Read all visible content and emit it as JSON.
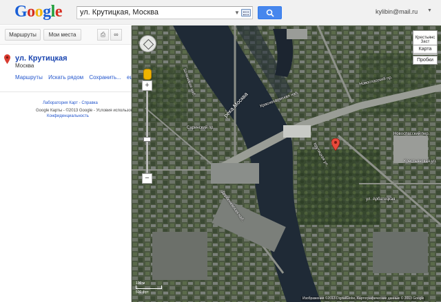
{
  "header": {
    "logo_letters": [
      "G",
      "o",
      "o",
      "g",
      "l",
      "e"
    ],
    "logo_colors": [
      "#1a5fd6",
      "#d62d20",
      "#f2b50f",
      "#1a5fd6",
      "#1f9e3a",
      "#d62d20"
    ],
    "search_value": "ул. Крутицкая, Москва",
    "user_email": "kylibin@mail.ru",
    "search_button_color": "#4787ed"
  },
  "left_panel": {
    "toolbar": {
      "directions_label": "Маршруты",
      "my_places_label": "Мои места"
    },
    "place": {
      "title": "ул. Крутицкая",
      "subtitle": "Москва"
    },
    "actions": {
      "directions": "Маршруты",
      "search_nearby": "Искать рядом",
      "save": "Сохранить...",
      "more": "ещё▾"
    },
    "footer": {
      "labs_help": "Лаборатория Карт - Справка",
      "copyright": "Google Карты - ©2013 Google - Условия использования -",
      "privacy": "Конфиденциальность"
    }
  },
  "map": {
    "layer_label": "Крестьянс Заст",
    "map_button": "Карта",
    "traffic_button": "Пробки",
    "zoom_in": "+",
    "zoom_out": "−",
    "river_label": "река Москва",
    "scale_labels": [
      "100 м",
      "500 фут"
    ],
    "attribution": "Изображения ©2013 DigitalGlobe, Картографические данные © 2013 Google",
    "street_labels": [
      "Шлюзовая наб.",
      "Саринский пр.",
      "Краснохолмская наб.",
      "Новоспасский пр.",
      "Крутицкая ул.",
      "ул. Арбатецкая",
      "Крестьянская ул.",
      "Дербеневская наб.",
      "Новоспасский пер."
    ]
  }
}
